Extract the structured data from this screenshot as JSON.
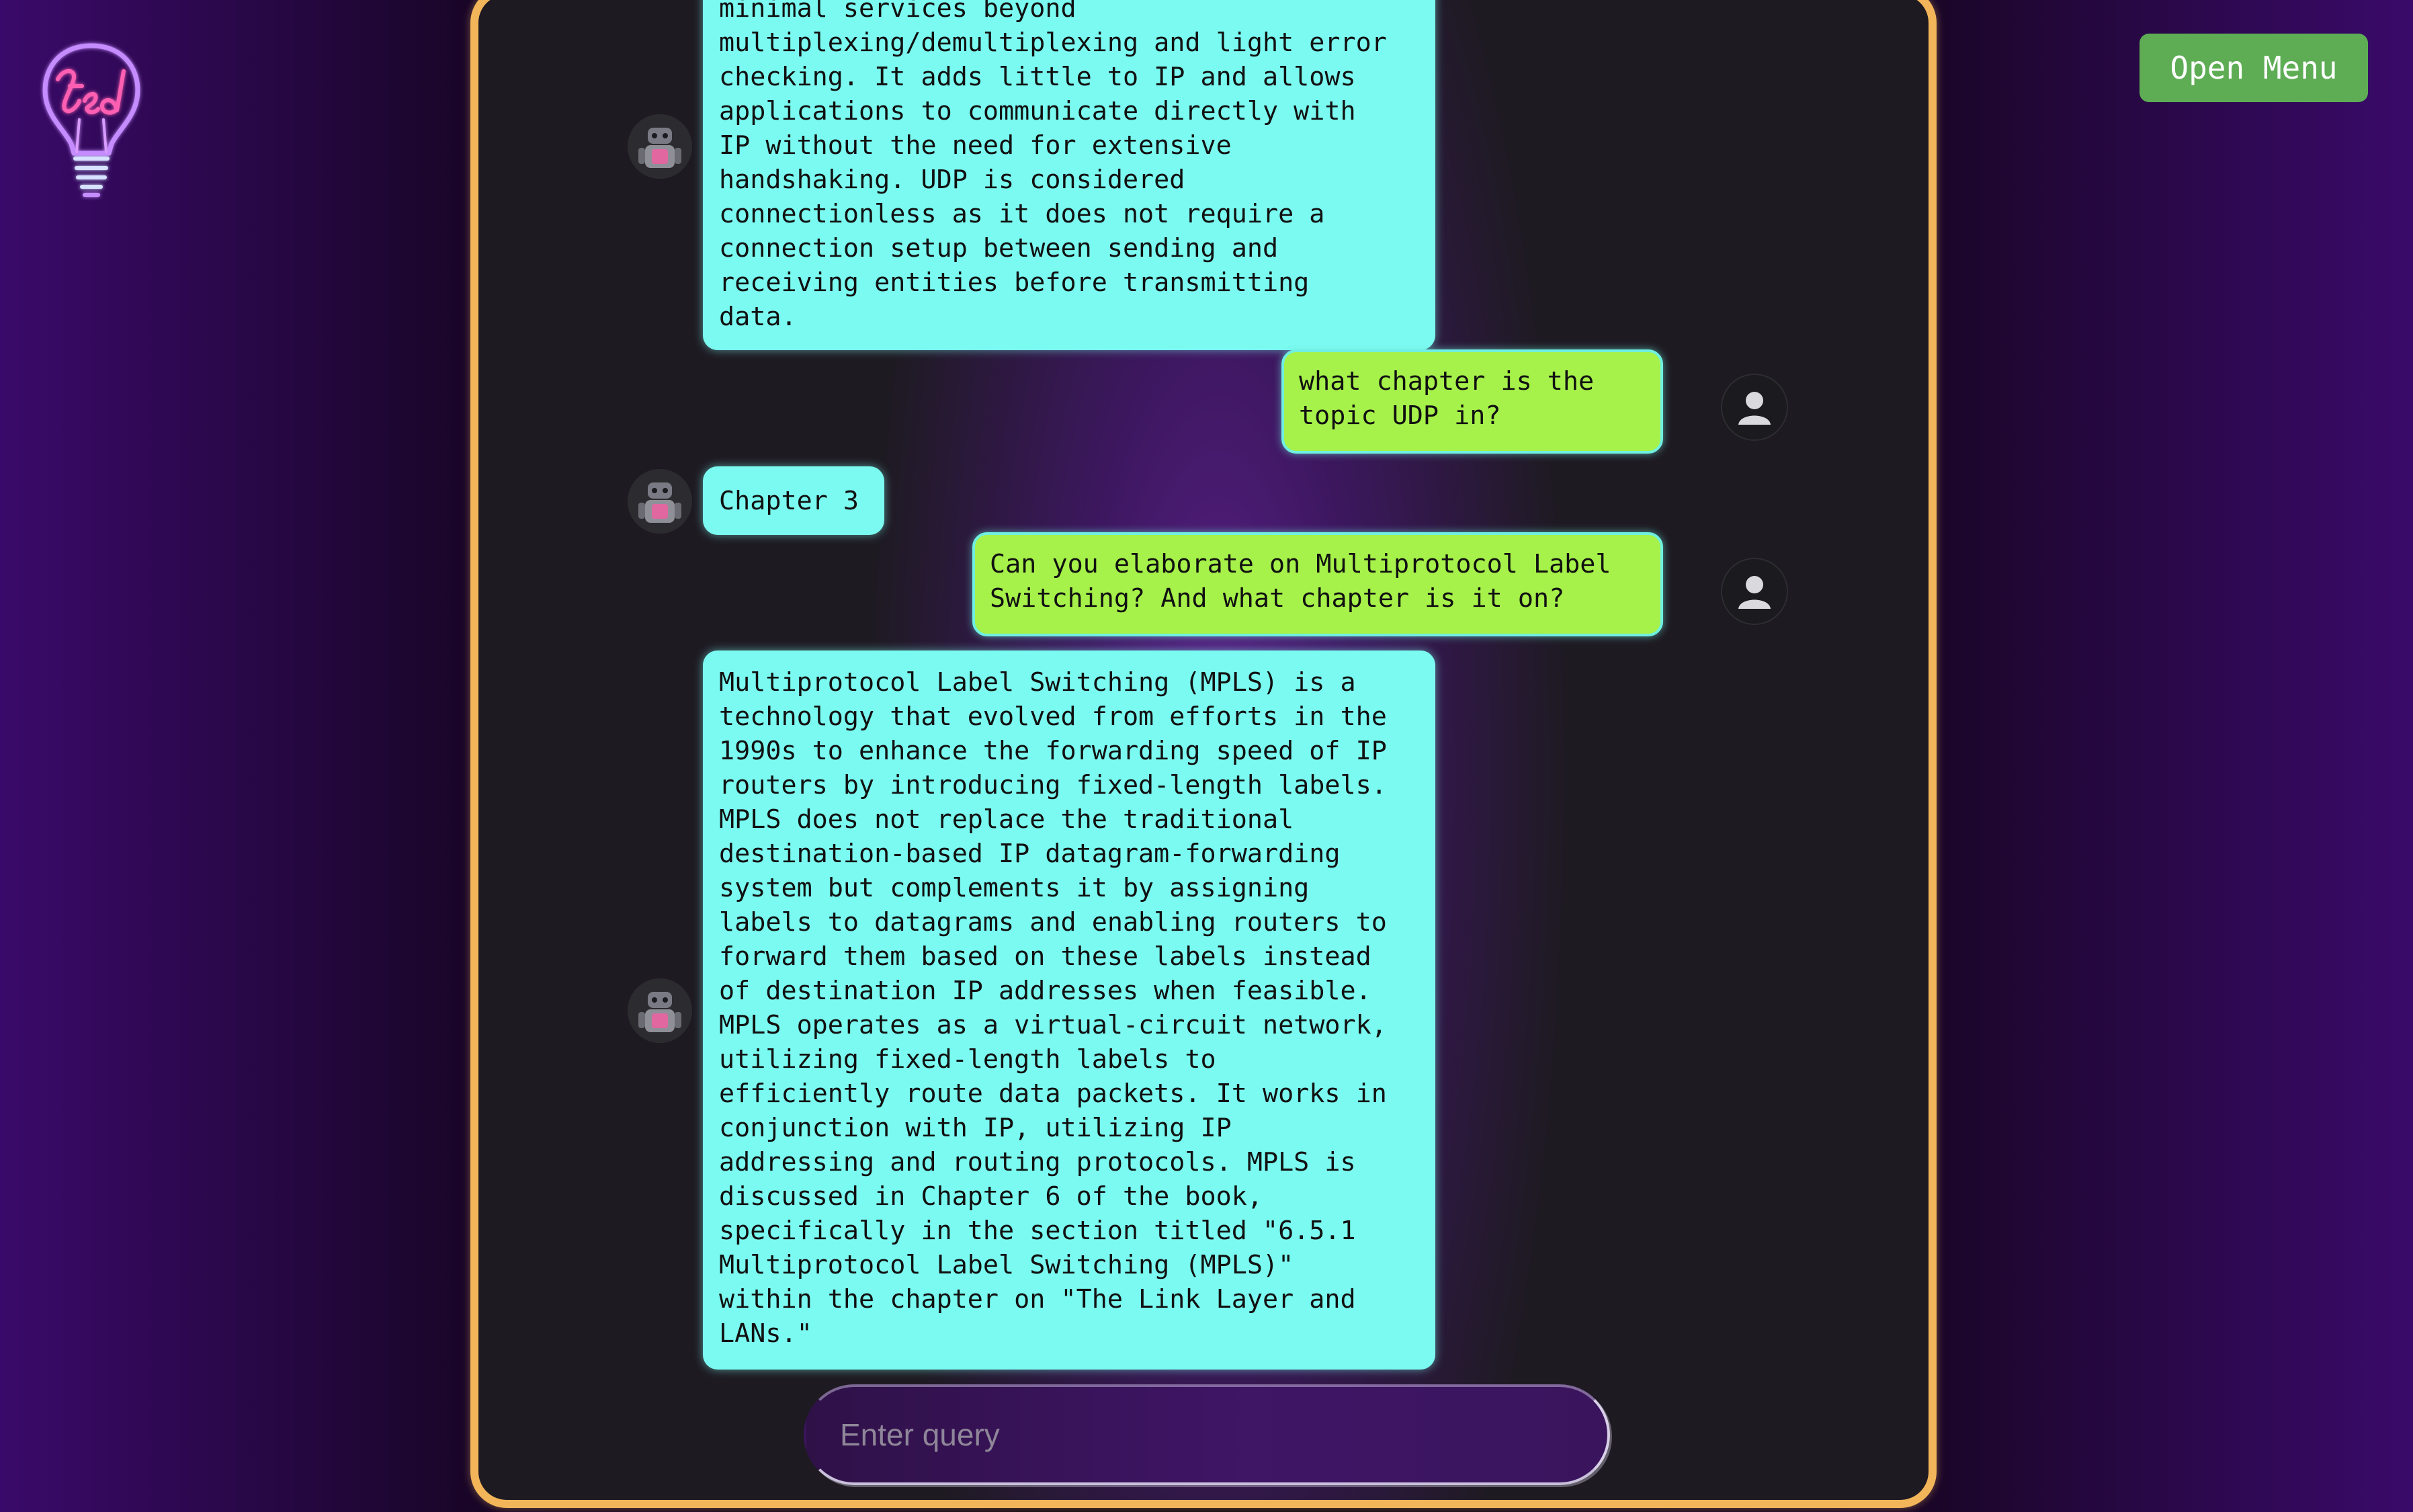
{
  "header": {
    "open_menu_label": "Open Menu"
  },
  "chat": {
    "messages": [
      {
        "role": "bot",
        "text": "minimal services beyond\nmultiplexing/demultiplexing and light error\nchecking. It adds little to IP and allows\napplications to communicate directly with\nIP without the need for extensive\nhandshaking. UDP is considered\nconnectionless as it does not require a\nconnection setup between sending and\nreceiving entities before transmitting\ndata."
      },
      {
        "role": "user",
        "text": "what chapter is the\ntopic UDP in?"
      },
      {
        "role": "bot",
        "text": "Chapter 3"
      },
      {
        "role": "user",
        "text": "Can you elaborate on Multiprotocol Label\nSwitching? And what chapter is it on?"
      },
      {
        "role": "bot",
        "text": "Multiprotocol Label Switching (MPLS) is a\ntechnology that evolved from efforts in the\n1990s to enhance the forwarding speed of IP\nrouters by introducing fixed-length labels.\nMPLS does not replace the traditional\ndestination-based IP datagram-forwarding\nsystem but complements it by assigning\nlabels to datagrams and enabling routers to\nforward them based on these labels instead\nof destination IP addresses when feasible.\nMPLS operates as a virtual-circuit network,\nutilizing fixed-length labels to\nefficiently route data packets. It works in\nconjunction with IP, utilizing IP\naddressing and routing protocols. MPLS is\ndiscussed in Chapter 6 of the book,\nspecifically in the section titled \"6.5.1\nMultiprotocol Label Switching (MPLS)\"\nwithin the chapter on \"The Link Layer and\nLANs.\""
      }
    ]
  },
  "query": {
    "placeholder": "Enter query",
    "value": ""
  },
  "colors": {
    "panel_border": "#f2b55a",
    "bot_bubble": "#7bfaf1",
    "user_bubble": "#a6f14a",
    "menu_button": "#5ead55"
  },
  "icons": {
    "logo": "ted-neon-lightbulb-logo",
    "bot_avatar": "robot-icon",
    "user_avatar": "user-icon"
  }
}
